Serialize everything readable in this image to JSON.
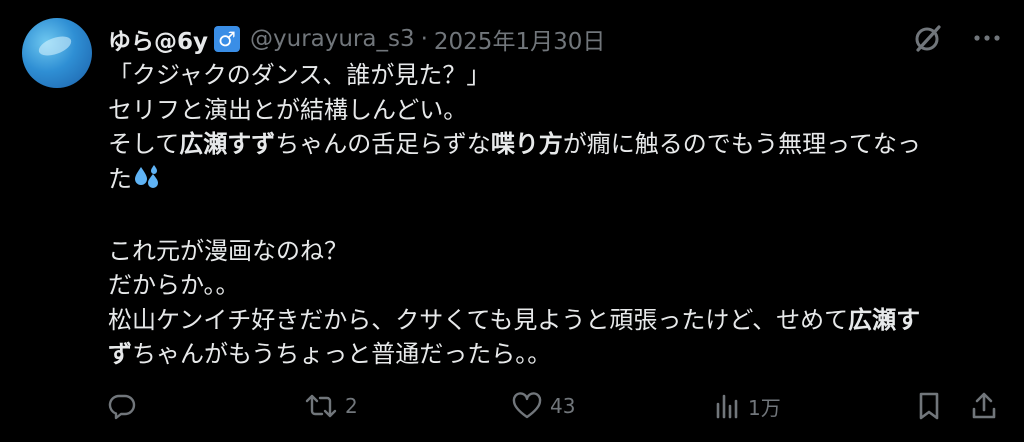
{
  "tweet": {
    "display_name": "ゆら@6y",
    "badge": "♂",
    "handle": "@yurayura_s3",
    "separator": "·",
    "date": "2025年1月30日",
    "body": {
      "line1": "「クジャクのダンス、誰が見た？」",
      "line2": "セリフと演出とが結構しんどい。",
      "line3_a": "そして",
      "line3_b": "広瀬すず",
      "line3_c": "ちゃんの舌足らずな",
      "line3_d": "喋り方",
      "line3_e": "が癇に触るのでもう無理ってなっ",
      "line4": "た",
      "line5": "これ元が漫画なのね？",
      "line6": "だからか。。",
      "line7_a": "松山ケンイチ好きだから、クサくても見ようと頑張ったけど、せめて",
      "line7_b": "広瀬す",
      "line8_a": "ず",
      "line8_b": "ちゃんがもうちょっと普通だったら。。"
    },
    "actions": {
      "reply_count": "",
      "retweet_count": "2",
      "like_count": "43",
      "view_count": "1万"
    }
  },
  "icons": {
    "grok": "grok-slash-icon",
    "more": "more-dots-icon",
    "reply": "reply-bubble-icon",
    "retweet": "retweet-icon",
    "like": "heart-icon",
    "views": "analytics-bars-icon",
    "bookmark": "bookmark-icon",
    "share": "share-upload-icon",
    "sweat": "sweat-droplets-emoji"
  },
  "colors": {
    "background": "#000000",
    "text_primary": "#e7e9ea",
    "text_secondary": "#71767b",
    "badge_blue": "#3a8ee6",
    "sweat_blue": "#5fb3f5"
  }
}
